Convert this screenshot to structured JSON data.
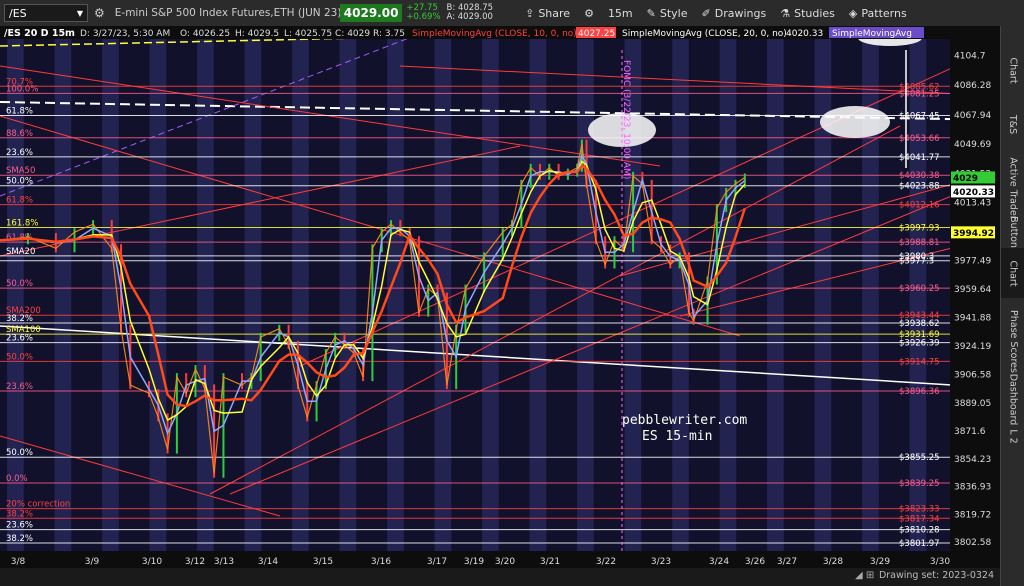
{
  "toolbar": {
    "symbol": "/ES",
    "description": "E-mini S&P 500 Index Futures,ETH (JUN 23)",
    "last_price": "4029.00",
    "change": "+27.75",
    "change_pct": "+0.69%",
    "bid": "B: 4028.75",
    "ask": "A: 4029.00",
    "share": "Share",
    "timeframe": "15m",
    "style": "Style",
    "drawings": "Drawings",
    "studies": "Studies",
    "patterns": "Patterns",
    "colors": {
      "bg": "#2b2b2b",
      "last_bg": "#1e7a1e",
      "change": "#33cc33"
    }
  },
  "right_tabs": [
    "Chart",
    "T&S",
    "Active Trader",
    "Buttons",
    "Chart",
    "Phase Scores",
    "Dashboard",
    "L 2"
  ],
  "status": {
    "drawing_set": "Drawing set: 2023-0324"
  },
  "chart_data": {
    "type": "candlestick",
    "header": {
      "title": "/ES 20 D 15m",
      "date": "D: 3/27/23, 5:30 AM",
      "ohlc": {
        "O": "4026.25",
        "H": "4029.5",
        "L": "4025.75",
        "C": "4029",
        "R": "3.75"
      },
      "studies": [
        {
          "label": "SimpleMovingAvg (CLOSE, 10, 0, no)",
          "value": "4027.25",
          "color": "#ff4040"
        },
        {
          "label": "SimpleMovingAvg (CLOSE, 20, 0, no)",
          "value": "4020.33",
          "color": "#ffffff"
        },
        {
          "label": "SimpleMovingAvg",
          "color": "#b48cff"
        }
      ]
    },
    "x_ticks": [
      "3/8",
      "3/9",
      "3/10",
      "3/12",
      "3/13",
      "3/14",
      "3/15",
      "3/16",
      "3/17",
      "3/19",
      "3/20",
      "3/21",
      "3/22",
      "3/23",
      "3/24",
      "3/26",
      "3/27",
      "3/28",
      "3/29",
      "3/30"
    ],
    "y_ticks": [
      "4104.7",
      "4086.28",
      "4067.94",
      "4049.69",
      "4031.52",
      "4013.43",
      "3995.3",
      "3977.49",
      "3959.64",
      "3941.88",
      "3924.19",
      "3906.58",
      "3889.05",
      "3871.6",
      "3854.23",
      "3836.93",
      "3819.72",
      "3802.58"
    ],
    "ylim": [
      3797,
      4115
    ],
    "levels": [
      {
        "label": "100.0%",
        "price": 4081.25,
        "color": "#ff5c8a",
        "right": "$4081.25"
      },
      {
        "label": "70.7%",
        "price": 4085.62,
        "color": "#ff4040",
        "right": "$4085.62"
      },
      {
        "label": "61.8%",
        "price": 4067.45,
        "color": "#ffffff",
        "right": "$4067.45"
      },
      {
        "label": "88.6%",
        "price": 4053.66,
        "color": "#ff5c8a",
        "right": "$4053.66"
      },
      {
        "label": "23.6%",
        "price": 4041.77,
        "color": "#ffffff",
        "right": "$4041.77"
      },
      {
        "label": "SMA50",
        "price": 4030.38,
        "color": "#ff5c8a",
        "right": "$4030.38"
      },
      {
        "label": "50.0%",
        "price": 4023.88,
        "color": "#ffffff",
        "right": "$4023.88"
      },
      {
        "label": "61.8%",
        "price": 4012.16,
        "color": "#ff4040",
        "right": "$4012.16"
      },
      {
        "label": "161.8%",
        "price": 3997.93,
        "color": "#ffff33",
        "right": "$3997.93"
      },
      {
        "label": "61.8%",
        "price": 3988.81,
        "color": "#ff5c8a",
        "right": "$3988.81"
      },
      {
        "label": "SMA20",
        "price": 3980.3,
        "color": "#ffffff",
        "right": "$3980.3"
      },
      {
        "label": "",
        "price": 3977.3,
        "color": "#ffffff",
        "right": "$3977.3"
      },
      {
        "label": "50.0%",
        "price": 3960.25,
        "color": "#ff5c8a",
        "right": "$3960.25"
      },
      {
        "label": "SMA200",
        "price": 3943.44,
        "color": "#ff4040",
        "right": "$3943.44"
      },
      {
        "label": "38.2%",
        "price": 3938.62,
        "color": "#ffffff",
        "right": "$3938.62"
      },
      {
        "label": "SMA100",
        "price": 3931.69,
        "color": "#ffff33",
        "right": "$3931.69"
      },
      {
        "label": "23.6%",
        "price": 3926.39,
        "color": "#ffffff",
        "right": "$3926.39"
      },
      {
        "label": "50.0%",
        "price": 3914.75,
        "color": "#ff4040",
        "right": "$3914.75"
      },
      {
        "label": "23.6%",
        "price": 3896.36,
        "color": "#ff5c8a",
        "right": "$3896.36"
      },
      {
        "label": "50.0%",
        "price": 3855.25,
        "color": "#ffffff",
        "right": "$3855.25"
      },
      {
        "label": "0.0%",
        "price": 3839.25,
        "color": "#ff5c8a",
        "right": "$3839.25"
      },
      {
        "label": "20% correction",
        "price": 3823.33,
        "color": "#ff4040",
        "right": "$3823.33"
      },
      {
        "label": "38.2%",
        "price": 3817.34,
        "color": "#ff4040",
        "right": "$3817.34"
      },
      {
        "label": "23.6%",
        "price": 3810.28,
        "color": "#ffffff",
        "right": "$3810.28"
      },
      {
        "label": "38.2%",
        "price": 3801.97,
        "color": "#ffffff",
        "right": "$3801.97"
      }
    ],
    "price_tags": [
      {
        "value": "4029",
        "color": "#33cc33",
        "text_color": "#000000",
        "price": 4029
      },
      {
        "value": "4020.33",
        "color": "#ffffff",
        "text_color": "#000000",
        "price": 4020.33
      },
      {
        "value": "3994.92",
        "color": "#ffff33",
        "text_color": "#000000",
        "price": 3994.92
      }
    ],
    "annotations": {
      "fomc": "FOMC (3/22/23, 10:00 AM)",
      "watermark_1": "pebblewriter.com",
      "watermark_2": "ES 15-min"
    },
    "price_path": [
      [
        0,
        3990
      ],
      [
        0.03,
        3992
      ],
      [
        0.06,
        3985
      ],
      [
        0.08,
        3995
      ],
      [
        0.1,
        4000
      ],
      [
        0.12,
        3985
      ],
      [
        0.13,
        3935
      ],
      [
        0.14,
        3900
      ],
      [
        0.16,
        3895
      ],
      [
        0.17,
        3880
      ],
      [
        0.18,
        3860
      ],
      [
        0.19,
        3905
      ],
      [
        0.2,
        3895
      ],
      [
        0.21,
        3910
      ],
      [
        0.22,
        3898
      ],
      [
        0.23,
        3845
      ],
      [
        0.24,
        3905
      ],
      [
        0.26,
        3900
      ],
      [
        0.27,
        3905
      ],
      [
        0.28,
        3930
      ],
      [
        0.3,
        3935
      ],
      [
        0.31,
        3925
      ],
      [
        0.32,
        3900
      ],
      [
        0.33,
        3880
      ],
      [
        0.34,
        3900
      ],
      [
        0.35,
        3920
      ],
      [
        0.36,
        3930
      ],
      [
        0.37,
        3925
      ],
      [
        0.38,
        3920
      ],
      [
        0.39,
        3905
      ],
      [
        0.4,
        3985
      ],
      [
        0.41,
        3995
      ],
      [
        0.42,
        4000
      ],
      [
        0.43,
        3995
      ],
      [
        0.44,
        3990
      ],
      [
        0.45,
        3945
      ],
      [
        0.46,
        3960
      ],
      [
        0.47,
        3955
      ],
      [
        0.48,
        3900
      ],
      [
        0.49,
        3935
      ],
      [
        0.5,
        3960
      ],
      [
        0.52,
        3980
      ],
      [
        0.54,
        3995
      ],
      [
        0.55,
        4000
      ],
      [
        0.56,
        4025
      ],
      [
        0.57,
        4035
      ],
      [
        0.58,
        4030
      ],
      [
        0.59,
        4035
      ],
      [
        0.6,
        4030
      ],
      [
        0.61,
        4032
      ],
      [
        0.62,
        4035
      ],
      [
        0.625,
        4050
      ],
      [
        0.63,
        4025
      ],
      [
        0.64,
        3990
      ],
      [
        0.65,
        3975
      ],
      [
        0.66,
        3990
      ],
      [
        0.67,
        3985
      ],
      [
        0.68,
        4030
      ],
      [
        0.69,
        4025
      ],
      [
        0.7,
        3990
      ],
      [
        0.71,
        3985
      ],
      [
        0.72,
        3975
      ],
      [
        0.73,
        3980
      ],
      [
        0.74,
        3945
      ],
      [
        0.745,
        3940
      ],
      [
        0.76,
        3965
      ],
      [
        0.77,
        4010
      ],
      [
        0.78,
        4020
      ],
      [
        0.79,
        4025
      ],
      [
        0.8,
        4029
      ]
    ]
  }
}
